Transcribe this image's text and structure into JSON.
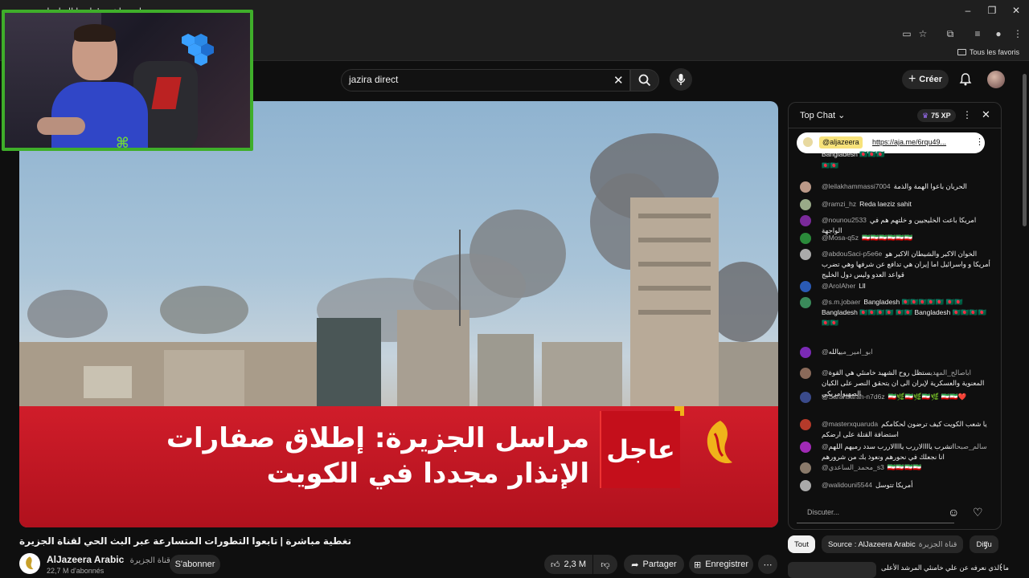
{
  "browser": {
    "tab_title": "تغطية مباشرة | تابعوا التطورات",
    "bookmarks_label": "Tous les favoris"
  },
  "masthead": {
    "search_value": "jazira direct",
    "create_label": "Créer"
  },
  "video": {
    "banner_line1": "مراسل الجزيرة: إطلاق صفارات",
    "banner_line2": "الإنذار مجددا في الكويت",
    "banner_tag": "عاجل",
    "title": "تغطية مباشرة | تابعوا التطورات المتسارعة عبر البث الحي لقناة الجزيرة",
    "channel_name": "AlJazeera Arabic",
    "channel_name_ar": "قناة الجزيرة",
    "subscribers": "22,7 M d'abonnés",
    "subscribe_label": "S'abonner",
    "likes": "2,3 M",
    "share_label": "Partager",
    "save_label": "Enregistrer"
  },
  "chat": {
    "title": "Top Chat",
    "xp": "75 XP",
    "pinned_author": "@aljazeera",
    "pinned_link": "https://aja.me/6rqu49...",
    "input_placeholder": "Discuter...",
    "messages": [
      {
        "author": "",
        "text": "Bangladesh 🇧🇩🇧🇩🇧🇩",
        "color": "#3a3"
      },
      {
        "author": "",
        "text": "🇧🇩🇧🇩",
        "color": "#3a3"
      },
      {
        "author": "@leilakhammassi7004",
        "text": "الحربان باعوا الهمة والذمة",
        "color": "#b98"
      },
      {
        "author": "@ramzi_hz",
        "text": "Reda laeziz sahit",
        "color": "#9a8"
      },
      {
        "author": "@nounou2533",
        "text": "امريكا باعت الخليجيين و خلتهم هم في الواجهة",
        "color": "#7a2a9a"
      },
      {
        "author": "@Mosa-q5z",
        "text": "🇮🇷🇮🇷🇮🇷🇮🇷🇮🇷🇮🇷",
        "color": "#2a8a3a"
      },
      {
        "author": "@abdouSaci-p5e6e",
        "text": "الخوان الاكبر والشيطان الاكبر هو أمريكا و واسرائيل اما إيران هي تدافع عن شرفها وهي تضرب قواعد العدو وليس دول الخليج",
        "color": "#aaa"
      },
      {
        "author": "@AroIAher",
        "text": "Lll",
        "color": "#2a5ab5"
      },
      {
        "author": "@s.m.jobaer",
        "text": "Bangladesh 🇧🇩🇧🇩🇧🇩🇧🇩🇧🇩 🇧🇩🇧🇩 Bangladesh 🇧🇩🇧🇩🇧🇩🇧🇩 🇧🇩🇧🇩 Bangladesh 🇧🇩🇧🇩🇧🇩🇧🇩 🇧🇩🇧🇩",
        "color": "#3a8a5a"
      },
      {
        "author": "@ابو_امير_مي",
        "text": "يالله",
        "color": "#7a2ab5"
      },
      {
        "author": "@اباصالح_المهدي",
        "text": "ستظل روح الشهيد خامنئي هي القوة المعنوية والعسكرية لإيران الى ان يتحقق النصر على الكيان الصهيوامريكي",
        "color": "#8a6a5a"
      },
      {
        "author": "@Sarahsarah-n7d6z",
        "text": "🇮🇷🌿🇮🇷🌿🇮🇷🌿 🇮🇷🇮🇷❤️",
        "color": "#3a4a8a"
      },
      {
        "author": "@masterxquaruda",
        "text": "يا شعب الكويت كيف ترضون لحكامكم استضافة القتلة على ارضكم",
        "color": "#b53a2a"
      },
      {
        "author": "@سالم_صبحا",
        "text": "اتشرب ياااالاررب ياااالاررب سدد رميهم اللهم انا نجعلك في نحورهم ونعوذ بك من شرورهم",
        "color": "#a02ab5"
      },
      {
        "author": "@محمد_الساعدي_s3",
        "text": "🇮🇷🇮🇷🇮🇷🇮🇷",
        "color": "#8a7a6a"
      },
      {
        "author": "@walidouni5544",
        "text": "أمريكا تتوسل",
        "color": "#aaa"
      }
    ]
  },
  "filters": {
    "all": "Tout",
    "source": "Source : AlJazeera Arabic",
    "source_ar": "قناة الجزيرة",
    "more": "Diffu"
  },
  "related": {
    "first_title": "ما الذي نعرفه عن علي خامنئي المرشد الأعلى"
  }
}
